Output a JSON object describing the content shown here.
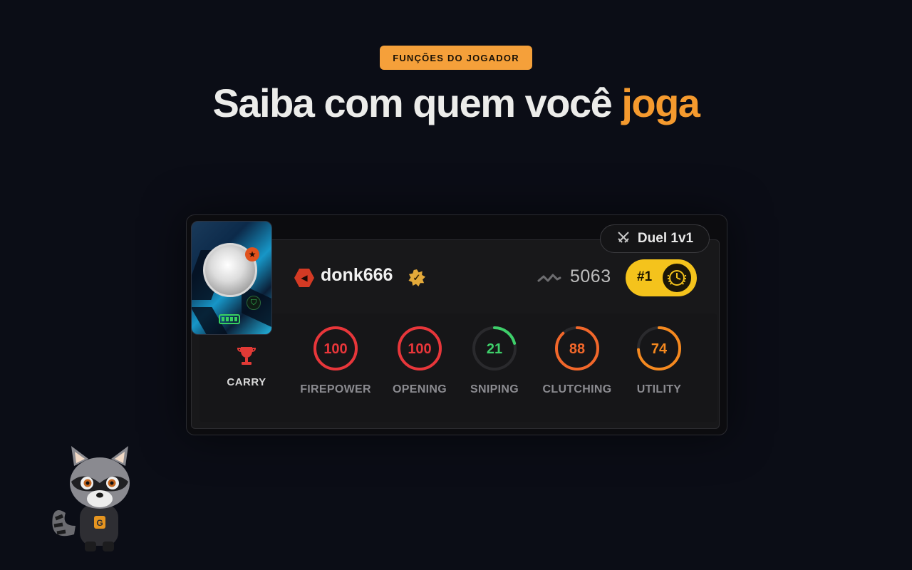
{
  "header": {
    "badge": "FUNÇÕES DO JOGADOR",
    "title_main": "Saiba com quem você",
    "title_accent": "joga"
  },
  "colors": {
    "accent": "#f59a2e",
    "background": "#0b0d16",
    "rank_gold": "#f4c31c",
    "stat_red": "#e8363a",
    "stat_green": "#3ecf6a",
    "stat_orange": "#f2672a",
    "stat_amber": "#f5891f"
  },
  "player": {
    "role": "CARRY",
    "role_icon": "trophy-icon",
    "username": "donk666",
    "elo": "5063",
    "rank": "#1",
    "mode": "Duel 1v1",
    "mode_icon": "crossed-swords-icon"
  },
  "stats": [
    {
      "label": "FIREPOWER",
      "value": 100,
      "color": "#e8363a"
    },
    {
      "label": "OPENING",
      "value": 100,
      "color": "#e8363a"
    },
    {
      "label": "SNIPING",
      "value": 21,
      "color": "#3ecf6a"
    },
    {
      "label": "CLUTCHING",
      "value": 88,
      "color": "#f2672a"
    },
    {
      "label": "UTILITY",
      "value": 74,
      "color": "#f5891f"
    }
  ]
}
